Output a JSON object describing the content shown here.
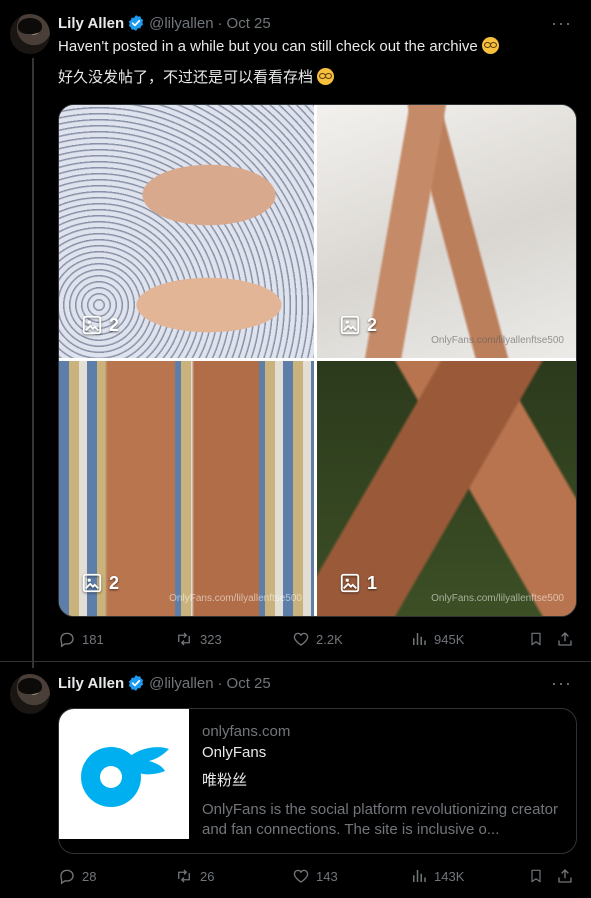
{
  "tweet1": {
    "author_name": "Lily Allen",
    "handle": "@lilyallen",
    "separator": "·",
    "date": "Oct 25",
    "more_label": "···",
    "text_en": "Haven't posted in a while but you can still check out the archive",
    "text_zh": "好久没发帖了，不过还是可以看看存档",
    "media": [
      {
        "count": "2",
        "watermark": ""
      },
      {
        "count": "2",
        "watermark": "OnlyFans.com/lilyallenftse500"
      },
      {
        "count": "2",
        "watermark": "OnlyFans.com/lilyallenftse500"
      },
      {
        "count": "1",
        "watermark": "OnlyFans.com/lilyallenftse500"
      }
    ],
    "stats": {
      "replies": "181",
      "reposts": "323",
      "likes": "2.2K",
      "views": "945K"
    }
  },
  "tweet2": {
    "author_name": "Lily Allen",
    "handle": "@lilyallen",
    "separator": "·",
    "date": "Oct 25",
    "more_label": "···",
    "card": {
      "domain": "onlyfans.com",
      "title": "OnlyFans",
      "subtitle": "唯粉丝",
      "description": "OnlyFans is the social platform revolutionizing creator and fan connections. The site is inclusive o..."
    },
    "stats": {
      "replies": "28",
      "reposts": "26",
      "likes": "143",
      "views": "143K"
    }
  },
  "colors": {
    "background": "#000000",
    "text": "#e7e9ea",
    "muted": "#71767b",
    "verified": "#1d9bf0",
    "border": "#2f3336",
    "onlyfans_blue": "#00aff0"
  }
}
